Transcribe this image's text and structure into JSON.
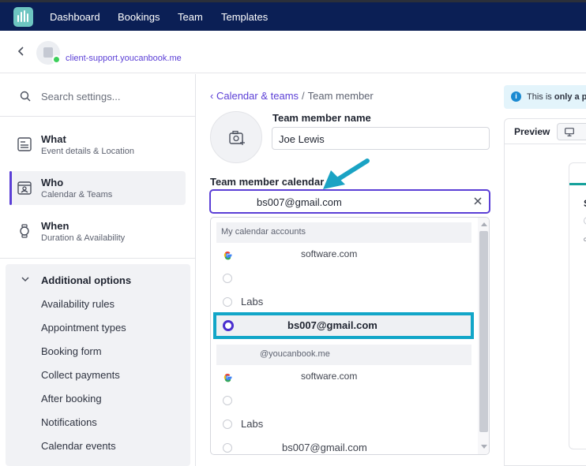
{
  "topnav": {
    "items": [
      {
        "label": "Dashboard"
      },
      {
        "label": "Bookings"
      },
      {
        "label": "Team"
      },
      {
        "label": "Templates"
      }
    ]
  },
  "account": {
    "domain": "client-support.youcanbook.me",
    "status_color": "#3ccf5b"
  },
  "sidebar": {
    "search_placeholder": "Search settings...",
    "items": [
      {
        "title": "What",
        "subtitle": "Event details & Location",
        "icon": "what-icon"
      },
      {
        "title": "Who",
        "subtitle": "Calendar & Teams",
        "icon": "who-icon",
        "active": true
      },
      {
        "title": "When",
        "subtitle": "Duration & Availability",
        "icon": "when-icon"
      }
    ],
    "additional": {
      "title": "Additional options",
      "links": [
        "Availability rules",
        "Appointment types",
        "Booking form",
        "Collect payments",
        "After booking",
        "Notifications",
        "Calendar events"
      ]
    }
  },
  "main": {
    "breadcrumb": {
      "parent": "Calendar & teams",
      "separator": "/",
      "current": "Team member"
    },
    "name_label": "Team member name",
    "name_value": "Joe Lewis",
    "calendar_label": "Team member calendar",
    "calendar_value": "bs007@gmail.com",
    "dropdown": {
      "group1_header": "My calendar accounts",
      "group1_options": [
        {
          "text": "software.com",
          "icon": "google-icon"
        },
        {
          "text": "",
          "icon": "radio"
        },
        {
          "text": "Labs",
          "icon": "radio"
        },
        {
          "text": "bs007@gmail.com",
          "icon": "radio-selected",
          "selected": true
        }
      ],
      "group2_header": "@youcanbook.me",
      "group2_options": [
        {
          "text": "software.com",
          "icon": "google-icon"
        },
        {
          "text": "",
          "icon": "radio"
        },
        {
          "text": "Labs",
          "icon": "radio"
        },
        {
          "text": "bs007@gmail.com",
          "icon": "radio"
        }
      ]
    }
  },
  "preview": {
    "banner_prefix": "This is",
    "banner_bold": "only a pr",
    "title": "Preview",
    "body_initial": "S",
    "body_small": "c"
  },
  "colors": {
    "nav_bg": "#0b1f55",
    "accent": "#5b3fd6",
    "highlight": "#12a6c8",
    "arrow": "#1aa3c4"
  }
}
